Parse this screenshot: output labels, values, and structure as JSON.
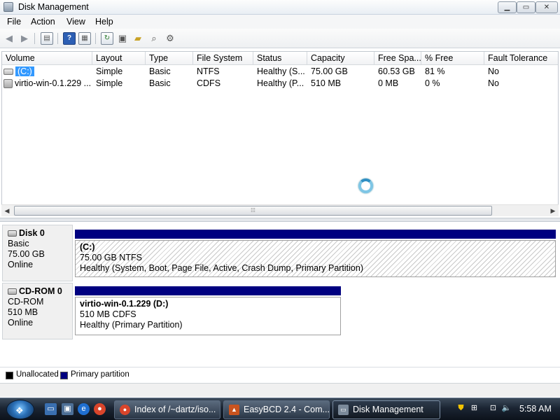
{
  "window": {
    "title": "Disk Management",
    "buttons": {
      "minimize": "▁",
      "maximize": "▭",
      "close": "✕"
    }
  },
  "menu": [
    "File",
    "Action",
    "View",
    "Help"
  ],
  "toolbar": {
    "icons": [
      "back-arrow-icon",
      "forward-arrow-icon",
      "show-hide-console-tree-icon",
      "help-icon",
      "properties-icon",
      "refresh-icon",
      "export-list-icon",
      "open-folder-icon",
      "search-icon",
      "settings-icon"
    ]
  },
  "volume_list": {
    "columns": [
      "Volume",
      "Layout",
      "Type",
      "File System",
      "Status",
      "Capacity",
      "Free Spa...",
      "% Free",
      "Fault Tolerance"
    ],
    "rows": [
      [
        "(C:)",
        "Simple",
        "Basic",
        "NTFS",
        "Healthy (S...",
        "75.00 GB",
        "60.53 GB",
        "81 %",
        "No"
      ],
      [
        "virtio-win-0.1.229 ...",
        "Simple",
        "Basic",
        "CDFS",
        "Healthy (P...",
        "510 MB",
        "0 MB",
        "0 %",
        "No"
      ]
    ],
    "scroll_grip": "⁞⁞⁞"
  },
  "disks": [
    {
      "name": "Disk 0",
      "type": "Basic",
      "size": "75.00 GB",
      "state": "Online",
      "partition": {
        "name": "(C:)",
        "size_fs": "75.00 GB NTFS",
        "status": "Healthy (System, Boot, Page File, Active, Crash Dump, Primary Partition)"
      }
    },
    {
      "name": "CD-ROM 0",
      "type": "CD-ROM",
      "size": "510 MB",
      "state": "Online",
      "partition": {
        "name": "virtio-win-0.1.229  (D:)",
        "size_fs": "510 MB CDFS",
        "status": "Healthy (Primary Partition)"
      }
    }
  ],
  "legend": [
    {
      "label": "Unallocated",
      "color": "#000000"
    },
    {
      "label": "Primary partition",
      "color": "#000080"
    }
  ],
  "taskbar": {
    "tasks": [
      "Index of /~dartz/iso...",
      "EasyBCD 2.4 - Com...",
      "Disk Management"
    ],
    "clock": "5:58 AM"
  }
}
